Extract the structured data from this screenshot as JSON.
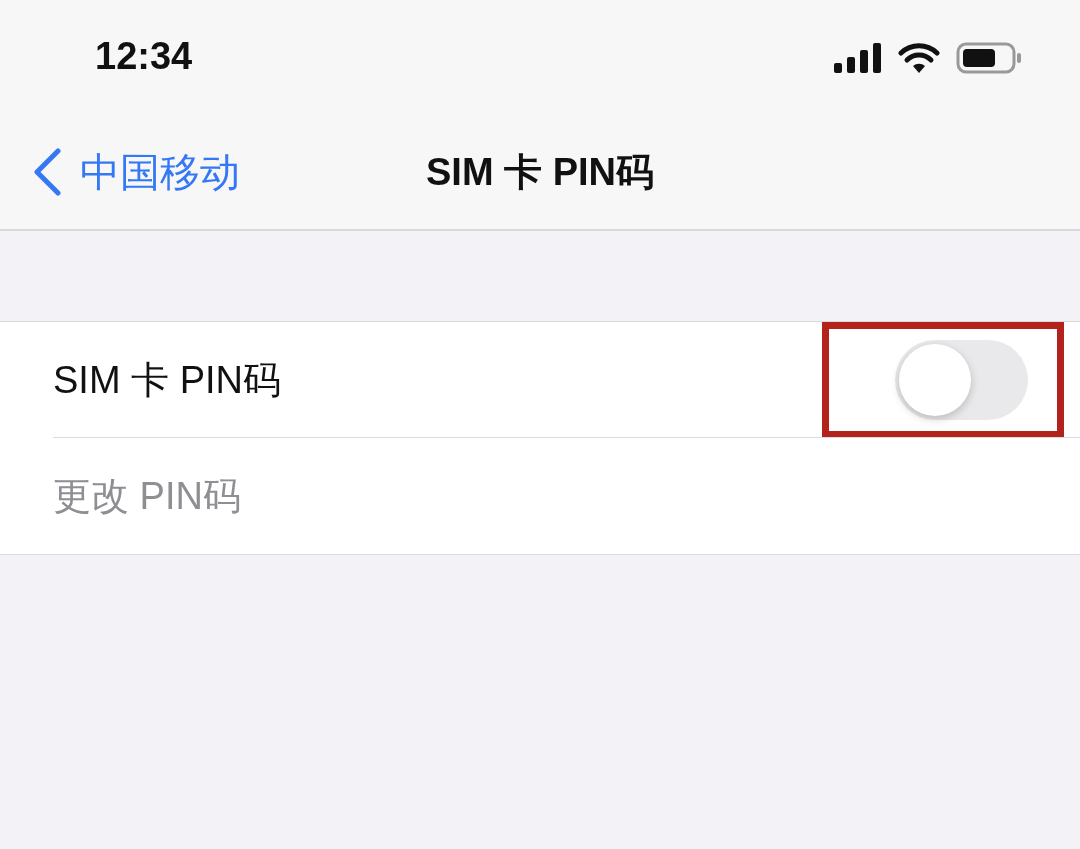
{
  "status_bar": {
    "time": "12:34"
  },
  "nav_bar": {
    "back_label": "中国移动",
    "title": "SIM 卡 PIN码"
  },
  "rows": [
    {
      "kind": "toggle",
      "label": "SIM 卡 PIN码",
      "on": false,
      "disabled": false,
      "highlighted": true
    },
    {
      "kind": "link",
      "label": "更改 PIN码",
      "disabled": true
    }
  ]
}
